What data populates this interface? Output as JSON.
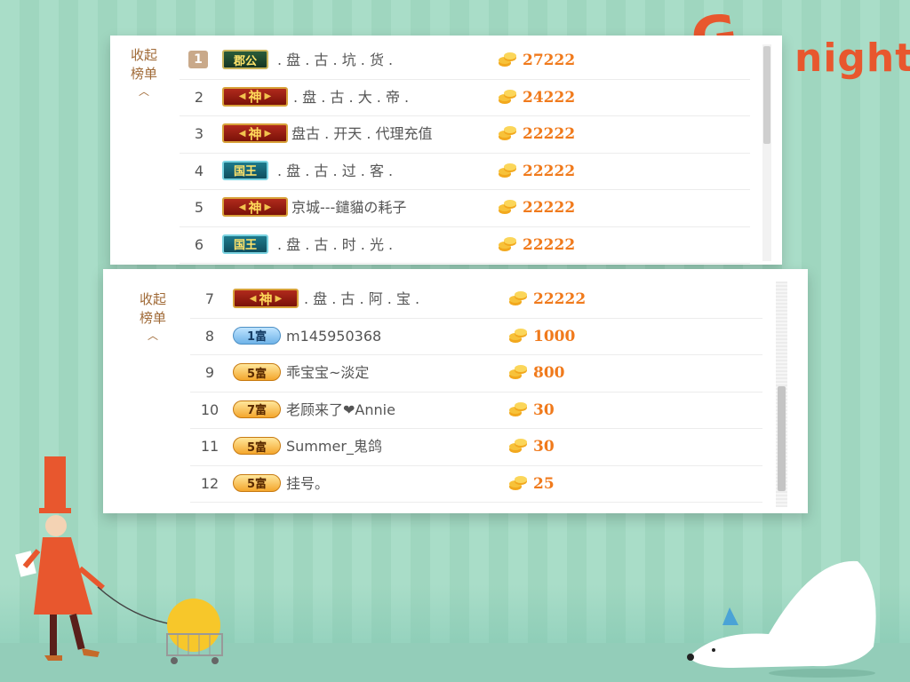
{
  "decoration": {
    "title_initial": "G",
    "title_word": "night"
  },
  "panels": [
    {
      "collapse_label_line1": "收起",
      "collapse_label_line2": "榜单",
      "rows": [
        {
          "rank": "1",
          "badge": "郡公",
          "name": ". 盘 . 古 . 坑 . 货 .",
          "score": "27222"
        },
        {
          "rank": "2",
          "badge": "神",
          "name": ". 盘 . 古 . 大 . 帝 .",
          "score": "24222"
        },
        {
          "rank": "3",
          "badge": "神",
          "name": "盘古 . 开天 . 代理充值",
          "score": "22222"
        },
        {
          "rank": "4",
          "badge": "国王",
          "name": ". 盘 . 古 . 过 . 客 .",
          "score": "22222"
        },
        {
          "rank": "5",
          "badge": "神",
          "name": "京城---鑓貓の耗子",
          "score": "22222"
        },
        {
          "rank": "6",
          "badge": "国王",
          "name": ". 盘 . 古 . 时 . 光 .",
          "score": "22222"
        }
      ]
    },
    {
      "collapse_label_line1": "收起",
      "collapse_label_line2": "榜单",
      "rows": [
        {
          "rank": "7",
          "badge": "神",
          "name": ". 盘 . 古 . 阿 . 宝 .",
          "score": "22222"
        },
        {
          "rank": "8",
          "badge": "1富",
          "name": "m145950368",
          "score": "1000"
        },
        {
          "rank": "9",
          "badge": "5富",
          "name": "乖宝宝~淡定",
          "score": "800"
        },
        {
          "rank": "10",
          "badge": "7富",
          "name": "老顾来了❤Annie",
          "score": "30"
        },
        {
          "rank": "11",
          "badge": "5富",
          "name": "Summer_鬼鸽",
          "score": "30"
        },
        {
          "rank": "12",
          "badge": "5富",
          "name": "挂号。",
          "score": "25"
        }
      ]
    }
  ],
  "colors": {
    "accent_orange": "#f07a1c",
    "label_brown": "#a06a37",
    "background_mint": "#a6dcc6"
  },
  "icons": {
    "coin": "gold-coin-stack-icon",
    "collapse": "caret-up-icon"
  }
}
